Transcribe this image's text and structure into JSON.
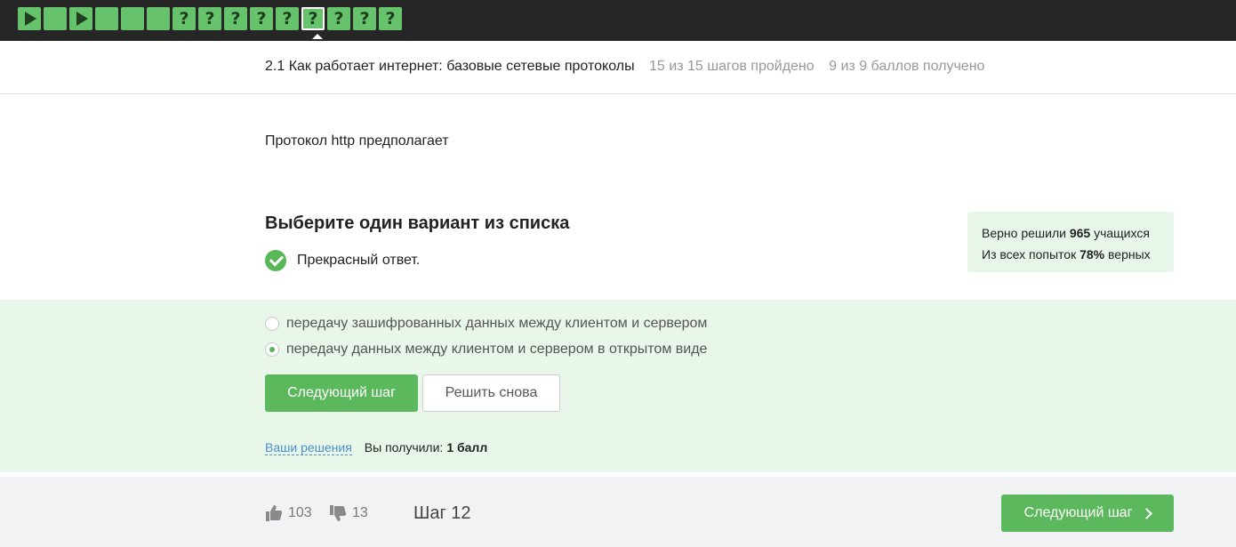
{
  "steps": [
    {
      "type": "video"
    },
    {
      "type": "text"
    },
    {
      "type": "video"
    },
    {
      "type": "text"
    },
    {
      "type": "text"
    },
    {
      "type": "text"
    },
    {
      "type": "quiz",
      "label": "?"
    },
    {
      "type": "quiz",
      "label": "?"
    },
    {
      "type": "quiz",
      "label": "?"
    },
    {
      "type": "quiz",
      "label": "?"
    },
    {
      "type": "quiz",
      "label": "?"
    },
    {
      "type": "quiz",
      "label": "?",
      "active": true
    },
    {
      "type": "quiz",
      "label": "?"
    },
    {
      "type": "quiz",
      "label": "?"
    },
    {
      "type": "quiz",
      "label": "?"
    }
  ],
  "lesson": {
    "title": "2.1 Как работает интернет: базовые сетевые протоколы",
    "progress": "15 из 15 шагов пройдено",
    "score": "9 из 9 баллов  получено"
  },
  "question": "Протокол http предполагает",
  "quiz": {
    "title": "Выберите один вариант из списка",
    "feedback": "Прекрасный ответ.",
    "options": [
      {
        "label": "передачу зашифрованных данных между клиентом и сервером",
        "selected": false
      },
      {
        "label": "передачу данных между клиентом и сервером в открытом виде",
        "selected": true
      }
    ],
    "next_label": "Следующий шаг",
    "retry_label": "Решить снова"
  },
  "stats": {
    "line1_prefix": "Верно решили",
    "solved_count": "965",
    "line1_suffix": "учащихся",
    "line2_prefix": "Из всех попыток",
    "correct_pct": "78%",
    "line2_suffix": "верных"
  },
  "result": {
    "solutions_link": "Ваши решения",
    "received_label": "Вы получили:",
    "received_value": "1 балл"
  },
  "footer": {
    "likes": "103",
    "dislikes": "13",
    "step_label": "Шаг 12",
    "next_label": "Следующий шаг"
  },
  "colors": {
    "accent": "#5cb85c",
    "step_tile": "#66c36b",
    "topbar": "#262626",
    "answer_area": "#e9f7ea"
  }
}
